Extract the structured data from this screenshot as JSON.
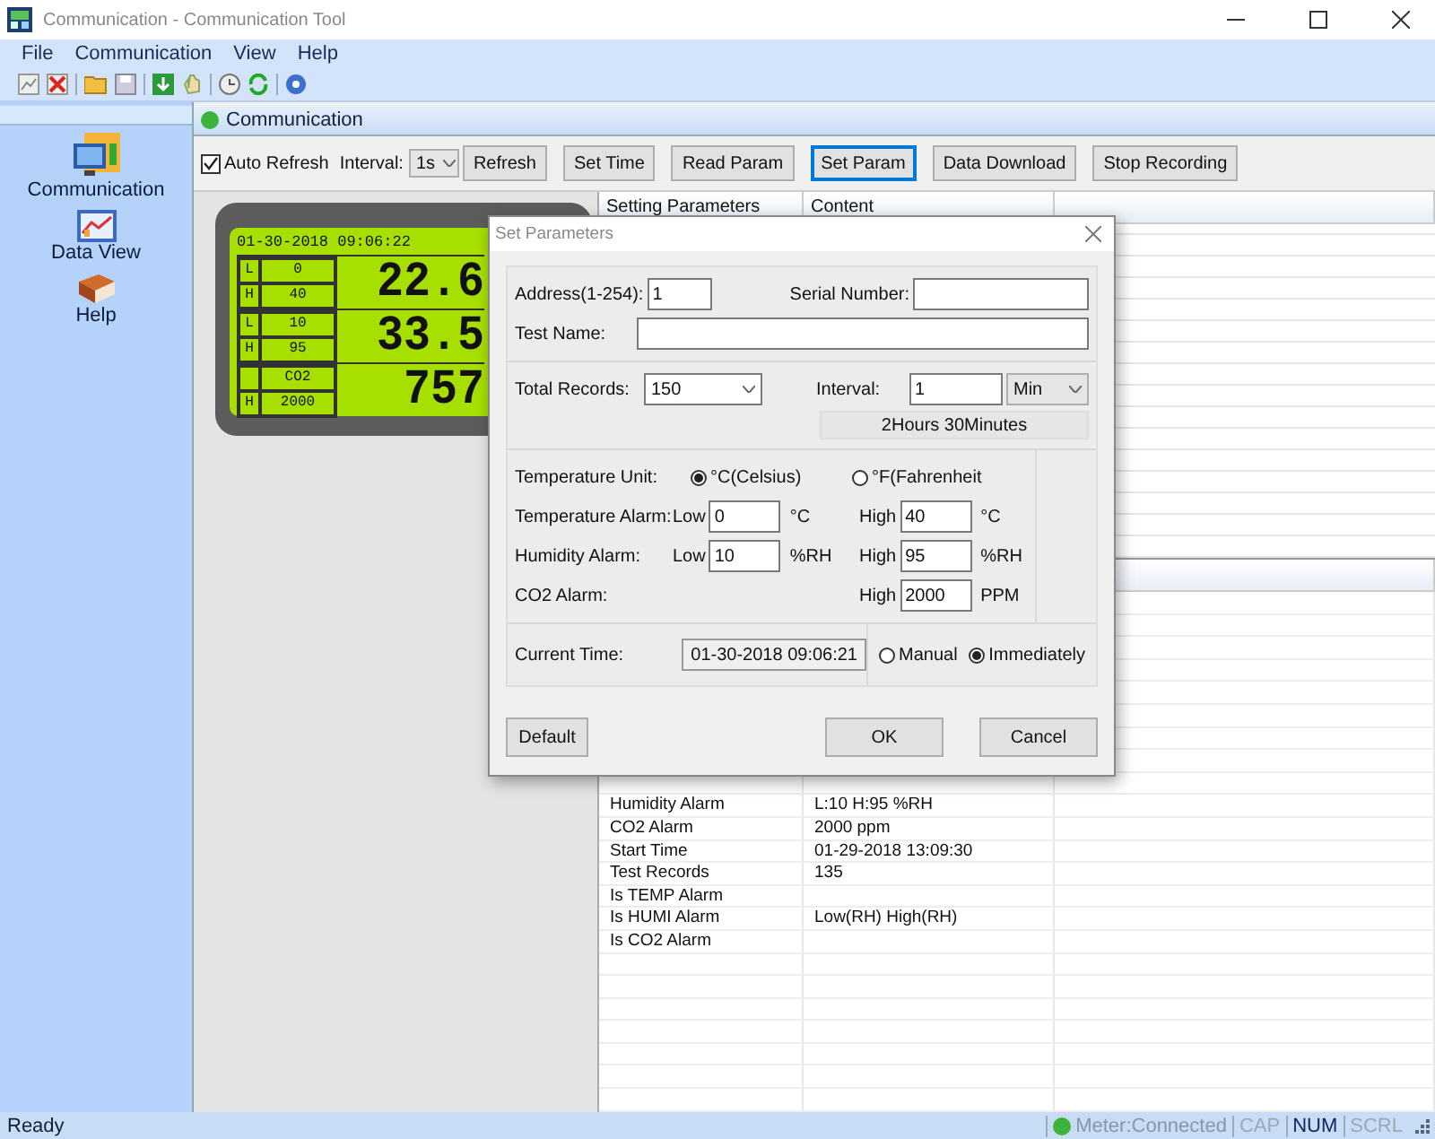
{
  "window": {
    "title": "Communication - Communication Tool"
  },
  "menu": [
    "File",
    "Communication",
    "View",
    "Help"
  ],
  "sidebar": {
    "items": [
      {
        "label": "Communication",
        "kind": "communication"
      },
      {
        "label": "Data View",
        "kind": "dataview"
      },
      {
        "label": "Help",
        "kind": "help"
      }
    ]
  },
  "panel": {
    "title": "Communication"
  },
  "controls": {
    "auto_refresh": {
      "label": "Auto Refresh",
      "checked": true
    },
    "interval_label": "Interval:",
    "interval_value": "1s",
    "buttons": [
      {
        "label": "Refresh",
        "selected": false
      },
      {
        "label": "Set Time",
        "selected": false
      },
      {
        "label": "Read Param",
        "selected": false
      },
      {
        "label": "Set Param",
        "selected": true
      },
      {
        "label": "Data Download",
        "selected": false
      },
      {
        "label": "Stop Recording",
        "selected": false
      }
    ]
  },
  "meter": {
    "datetime": "01-30-2018 09:06:22",
    "rows": [
      {
        "top_tag": "L",
        "top_value": "0",
        "bottom_tag": "H",
        "bottom_value": "40",
        "reading": "22.6"
      },
      {
        "top_tag": "L",
        "top_value": "10",
        "bottom_tag": "H",
        "bottom_value": "95",
        "reading": "33.5"
      },
      {
        "top_value": "CO2",
        "bottom_tag": "H",
        "bottom_value": "2000",
        "reading": "757"
      }
    ]
  },
  "table": {
    "columns": [
      "Setting Parameters",
      "Content"
    ]
  },
  "lower_table": {
    "rows": [
      {
        "name": "Humidity Alarm",
        "value": "L:10 H:95 %RH"
      },
      {
        "name": "CO2 Alarm",
        "value": "2000 ppm"
      },
      {
        "name": "Start Time",
        "value": "01-29-2018 13:09:30"
      },
      {
        "name": "Test Records",
        "value": "135"
      },
      {
        "name": "Is TEMP Alarm"
      },
      {
        "name": "Is HUMI Alarm",
        "value": "Low(RH) High(RH)"
      },
      {
        "name": "Is CO2 Alarm"
      }
    ]
  },
  "dialog": {
    "title": "Set Parameters",
    "address": {
      "label": "Address(1-254):",
      "value": "1"
    },
    "serial": {
      "label": "Serial Number:"
    },
    "test_name": {
      "label": "Test Name:"
    },
    "total_records": {
      "label": "Total Records:",
      "value": "150"
    },
    "interval": {
      "label": "Interval:",
      "value": "1",
      "unit": "Min",
      "duration": "2Hours 30Minutes"
    },
    "temperature_unit": {
      "label": "Temperature Unit:",
      "options": [
        {
          "label": "°C(Celsius)",
          "selected": true
        },
        {
          "label": "°F(Fahrenheit",
          "selected": false
        }
      ]
    },
    "alarms": [
      {
        "label": "Temperature Alarm:",
        "low_label": "Low",
        "low": "0",
        "low_unit": "°C",
        "high_label": "High",
        "high": "40",
        "high_unit": "°C"
      },
      {
        "label": "Humidity Alarm:",
        "low_label": "Low",
        "low": "10",
        "low_unit": "%RH",
        "high_label": "High",
        "high": "95",
        "high_unit": "%RH"
      },
      {
        "label": "CO2 Alarm:",
        "high_label": "High",
        "high": "2000",
        "high_unit": "PPM"
      }
    ],
    "current_time": {
      "label": "Current Time:",
      "value": "01-30-2018 09:06:21",
      "options": [
        {
          "label": "Manual",
          "selected": false
        },
        {
          "label": "Immediately",
          "selected": true
        }
      ]
    },
    "buttons": [
      {
        "label": "Default",
        "kind": "default"
      },
      {
        "label": "OK",
        "kind": "ok"
      },
      {
        "label": "Cancel",
        "kind": "cancel"
      }
    ]
  },
  "status_bar": {
    "text": "Ready",
    "connection": "Meter:Connected",
    "indicators": [
      {
        "label": "CAP",
        "on": false
      },
      {
        "label": "NUM",
        "on": true
      },
      {
        "label": "SCRL",
        "on": false
      }
    ]
  }
}
